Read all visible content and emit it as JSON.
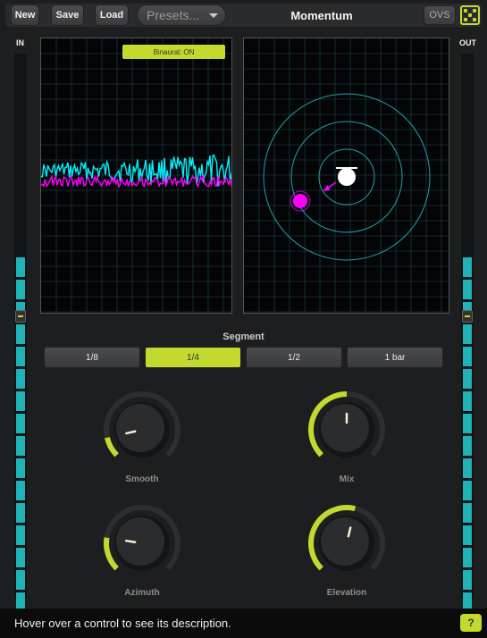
{
  "toolbar": {
    "new_label": "New",
    "save_label": "Save",
    "load_label": "Load",
    "presets_label": "Presets...",
    "title": "Momentum",
    "ovs_label": "OVS",
    "dice_icon": "dice-icon"
  },
  "meters": {
    "in_label": "IN",
    "out_label": "OUT",
    "color": "#1fb3b7"
  },
  "visualizer": {
    "binaural_label": "Binaural: ON",
    "accent": "#c4d92e",
    "wave_color_1": "#00f0ff",
    "wave_color_2": "#ff00ff"
  },
  "segment": {
    "label": "Segment",
    "options": [
      "1/8",
      "1/4",
      "1/2",
      "1 bar"
    ],
    "selected": "1/4"
  },
  "knobs": {
    "smooth": {
      "label": "Smooth",
      "value": 0.12
    },
    "mix": {
      "label": "Mix",
      "value": 0.5
    },
    "azimuth": {
      "label": "Azimuth",
      "value": 0.2
    },
    "elevation": {
      "label": "Elevation",
      "value": 0.55
    }
  },
  "status": {
    "text": "Hover over a control to see its description.",
    "help_label": "?"
  }
}
